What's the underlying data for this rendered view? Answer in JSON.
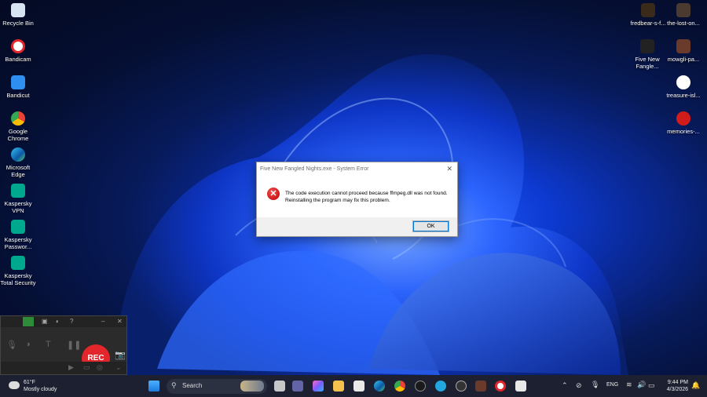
{
  "desktop": {
    "left_icons": [
      {
        "label": "Recycle Bin",
        "icon": "recycle-bin-icon"
      },
      {
        "label": "Bandicam",
        "icon": "bandicam-icon"
      },
      {
        "label": "Bandicut",
        "icon": "bandicut-icon"
      },
      {
        "label": "Google Chrome",
        "icon": "chrome-icon"
      },
      {
        "label": "Microsoft Edge",
        "icon": "edge-icon"
      },
      {
        "label": "Kaspersky VPN",
        "icon": "kaspersky-vpn-icon"
      },
      {
        "label": "Kaspersky Passwor...",
        "icon": "kaspersky-password-icon"
      },
      {
        "label": "Kaspersky Total Security",
        "icon": "kaspersky-total-icon"
      }
    ],
    "right_icons": [
      {
        "label": "fredbear-s-f...",
        "icon": "fredbear-icon"
      },
      {
        "label": "the-lost-on...",
        "icon": "lost-one-icon"
      },
      {
        "label": "Five New Fangle...",
        "icon": "five-new-fangled-icon"
      },
      {
        "label": "mowgli-pa...",
        "icon": "mowgli-icon"
      },
      {
        "label": "treasure-isl...",
        "icon": "treasure-island-icon"
      },
      {
        "label": "memories-...",
        "icon": "memories-icon"
      }
    ]
  },
  "dialog": {
    "title": "Five New Fangled Nights.exe - System Error",
    "close": "✕",
    "line1": "The code execution cannot proceed because ffmpeg.dll was not found.",
    "line2": "Reinstalling the program may fix this problem.",
    "ok_label": "OK",
    "icon_glyph": "✕"
  },
  "bandicam": {
    "rec_label": "REC",
    "title_icons": [
      "▣",
      "◐",
      "?",
      "–",
      "✕"
    ]
  },
  "taskbar": {
    "weather_temp": "61°F",
    "weather_desc": "Mostly cloudy",
    "search_label": "Search",
    "language": "ENG",
    "time": "9:44 PM",
    "date": "4/3/2026"
  },
  "colors": {
    "rec": "#e3262b",
    "taskbar": "#1c2030",
    "accent": "#0078d7"
  }
}
